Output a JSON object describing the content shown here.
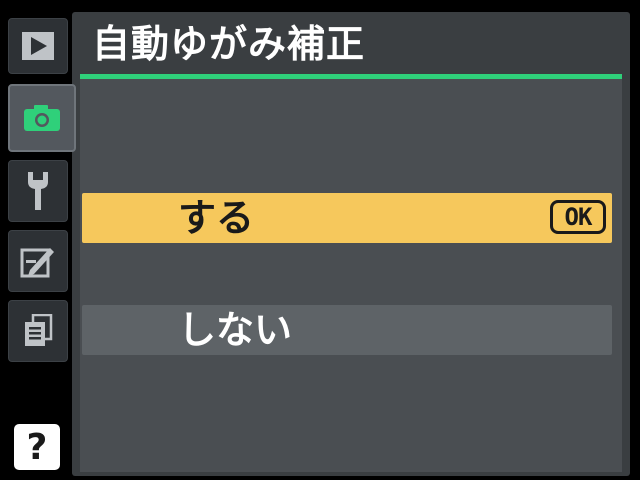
{
  "menu": {
    "title": "自動ゆがみ補正",
    "options": [
      {
        "label": "する",
        "selected": true,
        "confirm_badge": "OK"
      },
      {
        "label": "しない",
        "selected": false
      }
    ]
  },
  "sidebar": {
    "tabs": [
      {
        "name": "playback-icon",
        "active": false
      },
      {
        "name": "camera-icon",
        "active": true
      },
      {
        "name": "wrench-icon",
        "active": false
      },
      {
        "name": "retouch-icon",
        "active": false
      },
      {
        "name": "recent-settings-icon",
        "active": false
      }
    ],
    "help_label": "?"
  },
  "colors": {
    "accent": "#2fd07a",
    "highlight": "#f6c85c",
    "panel": "#3a3e41",
    "active_tab_icon": "#2fd07a"
  }
}
